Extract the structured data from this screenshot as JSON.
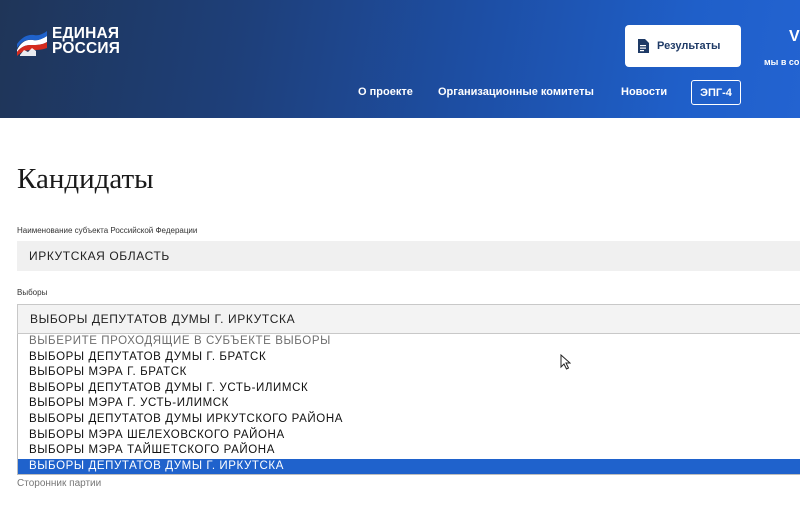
{
  "header": {
    "logo": {
      "line1": "ЕДИНАЯ",
      "line2": "РОССИЯ"
    },
    "results_label": "Результаты",
    "edge_glyph": "V",
    "edge_text": "мы в со",
    "nav": [
      "О проекте",
      "Организационные комитеты",
      "Новости"
    ],
    "epg_label": "ЭПГ-4"
  },
  "page": {
    "title": "Кандидаты",
    "region": {
      "label": "Наименование субъекта Российской Федерации",
      "value": "ИРКУТСКАЯ ОБЛАСТЬ"
    },
    "elections": {
      "label": "Выборы",
      "value": "ВЫБОРЫ ДЕПУТАТОВ ДУМЫ Г. ИРКУТСКА",
      "options": [
        "ВЫБЕРИТЕ ПРОХОДЯЩИЕ В СУБЪЕКТЕ ВЫБОРЫ",
        "ВЫБОРЫ ДЕПУТАТОВ ДУМЫ Г. БРАТСК",
        "ВЫБОРЫ МЭРА Г. БРАТСК",
        "ВЫБОРЫ ДЕПУТАТОВ ДУМЫ Г. УСТЬ-ИЛИМСК",
        "ВЫБОРЫ МЭРА Г. УСТЬ-ИЛИМСК",
        "ВЫБОРЫ ДЕПУТАТОВ ДУМЫ ИРКУТСКОГО РАЙОНА",
        "ВЫБОРЫ МЭРА ШЕЛЕХОВСКОГО РАЙОНА",
        "ВЫБОРЫ МЭРА ТАЙШЕТСКОГО РАЙОНА",
        "ВЫБОРЫ ДЕПУТАТОВ ДУМЫ Г. ИРКУТСКА"
      ]
    },
    "below_label": "Сторонник партии"
  },
  "colors": {
    "header_dark": "#1f3558",
    "header_bright": "#2363d1",
    "selected": "#1f62cc"
  },
  "icons": {
    "logo": "bear-flag-logo",
    "results": "document-icon",
    "cursor": "mouse-pointer-icon"
  }
}
